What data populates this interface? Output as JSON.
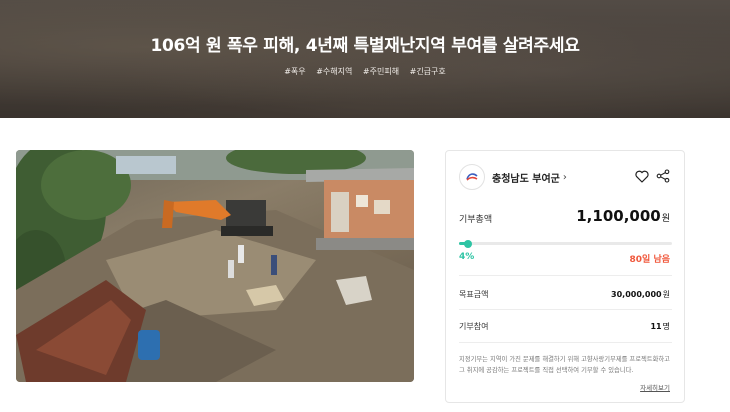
{
  "hero": {
    "title": "106억 원 폭우 피해, 4년째 특별재난지역 부여를 살려주세요",
    "tags": [
      "#폭우",
      "#수해지역",
      "#주민피해",
      "#긴급구호"
    ]
  },
  "campaign_card": {
    "organization": "충청남도 부여군",
    "total_label": "기부총액",
    "total_value": "1,100,000",
    "total_unit": "원",
    "progress_percent_label": "4%",
    "progress_fraction": 0.04,
    "days_left": "80일 남음",
    "goal_label": "목표금액",
    "goal_value": "30,000,000",
    "goal_unit": "원",
    "participants_label": "기부참여",
    "participants_value": "11",
    "participants_unit": "명",
    "notice": "지정기부는 지역이 가진 문제를 해결하기 위해 고향사랑기부제를 프로젝트화하고 그 취지에 공감하는 프로젝트를 직접 선택하여 기부할 수 있습니다.",
    "more_link": "자세히보기"
  },
  "colors": {
    "accent": "#2ec4a4",
    "days_left": "#f0583c"
  },
  "icons": {
    "org_logo": "county-emblem-icon",
    "favorite": "heart-icon",
    "share": "share-icon"
  }
}
